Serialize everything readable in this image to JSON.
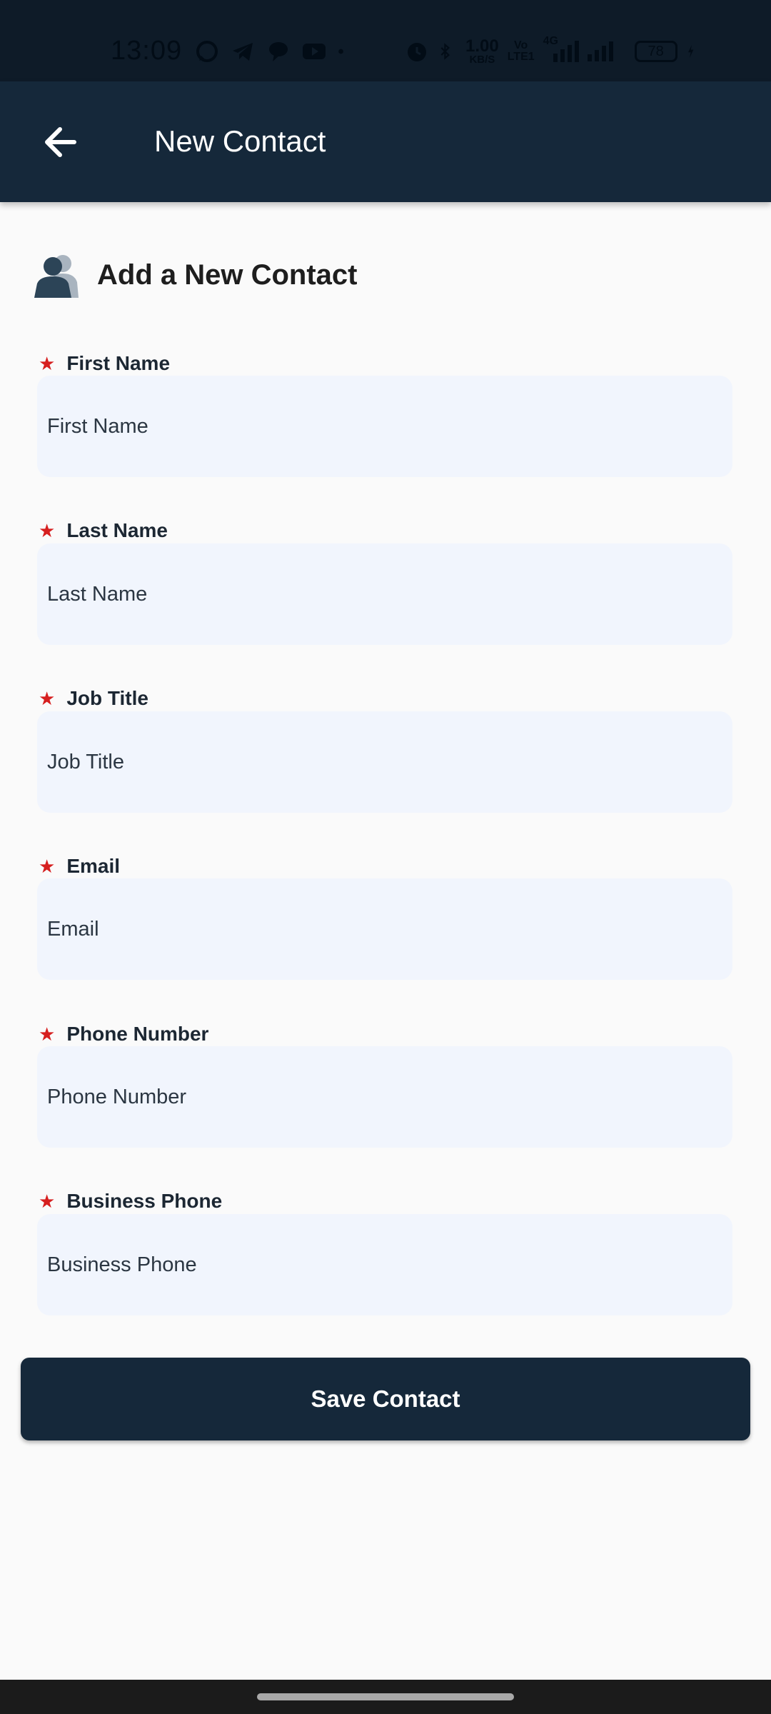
{
  "status_bar": {
    "time": "13:09",
    "data_speed_value": "1.00",
    "data_speed_unit": "KB/S",
    "volte_top": "Vo",
    "volte_bottom": "LTE1",
    "network_type": "4G",
    "battery_level": "78"
  },
  "app_bar": {
    "title": "New Contact"
  },
  "section": {
    "title": "Add a New Contact"
  },
  "form": {
    "first_name": {
      "label": "First Name",
      "placeholder": "First Name",
      "value": ""
    },
    "last_name": {
      "label": "Last Name",
      "placeholder": "Last Name",
      "value": ""
    },
    "job_title": {
      "label": "Job Title",
      "placeholder": "Job Title",
      "value": ""
    },
    "email": {
      "label": "Email",
      "placeholder": "Email",
      "value": ""
    },
    "phone_number": {
      "label": "Phone Number",
      "placeholder": "Phone Number",
      "value": ""
    },
    "business_phone": {
      "label": "Business Phone",
      "placeholder": "Business Phone",
      "value": ""
    },
    "required_marker": "★"
  },
  "actions": {
    "save_label": "Save Contact"
  },
  "colors": {
    "app_bar": "#15283a",
    "status_bar": "#0e1b28",
    "input_background": "#f1f5fd",
    "required_star": "#d61f1f",
    "page_background": "#fafafa"
  },
  "icons": {
    "back": "arrow-left-icon",
    "section": "contacts-silhouette-icon"
  }
}
